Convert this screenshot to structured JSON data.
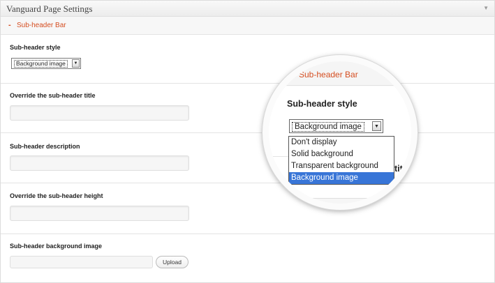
{
  "panel": {
    "title": "Vanguard Page Settings",
    "toggle_icon": "▼"
  },
  "section": {
    "collapse_icon": "-",
    "label": "Sub-header Bar"
  },
  "fields": {
    "subheader_style": {
      "label": "Sub-header style",
      "selected": "Background image"
    },
    "override_title": {
      "label": "Override the sub-header title",
      "value": ""
    },
    "description": {
      "label": "Sub-header description",
      "value": ""
    },
    "override_height": {
      "label": "Override the sub-header height",
      "value": ""
    },
    "background_image": {
      "label": "Sub-header background image",
      "value": "",
      "upload_label": "Upload"
    }
  },
  "magnifier": {
    "section_label": "Sub-header Bar",
    "field_label": "Sub-header style",
    "selected": "Background image",
    "options": [
      "Don't display",
      "Solid background",
      "Transparent background",
      "Background image"
    ],
    "selected_index": 3,
    "peek_text": "titl"
  },
  "colors": {
    "accent": "#d54e21",
    "selection": "#3875d7"
  }
}
